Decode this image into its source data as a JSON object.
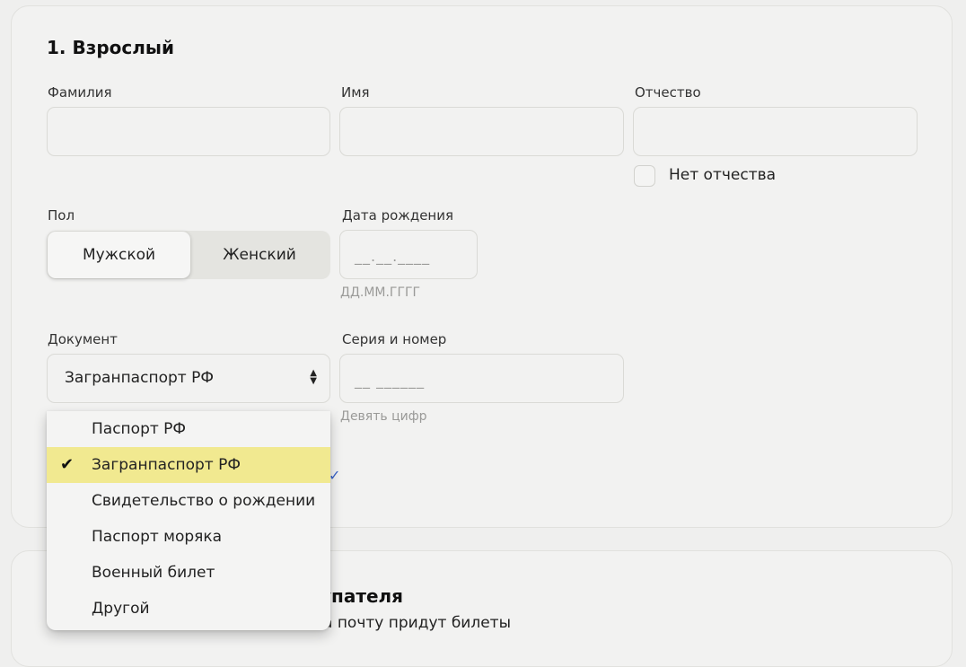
{
  "passenger": {
    "title": "1. Взрослый",
    "last_name": {
      "label": "Фамилия",
      "value": ""
    },
    "first_name": {
      "label": "Имя",
      "value": ""
    },
    "patronymic": {
      "label": "Отчество",
      "value": "",
      "no_patronymic_label": "Нет отчества",
      "no_patronymic_checked": false
    },
    "gender": {
      "label": "Пол",
      "options": [
        "Мужской",
        "Женский"
      ],
      "selected": "Мужской"
    },
    "birth_date": {
      "label": "Дата рождения",
      "mask": "__.__.____",
      "hint": "ДД.ММ.ГГГГ"
    },
    "document": {
      "label": "Документ",
      "selected": "Загранпаспорт РФ",
      "options": [
        "Паспорт РФ",
        "Загранпаспорт РФ",
        "Свидетельство о рождении",
        "Паспорт моряка",
        "Военный билет",
        "Другой"
      ],
      "selected_index": 1
    },
    "series_number": {
      "label": "Серия и номер",
      "mask": "__ ______",
      "hint": "Девять цифр"
    }
  },
  "buyer": {
    "title_fragment": "упателя",
    "subtitle_fragment": "а почту придут билеты"
  },
  "colors": {
    "selected_option_bg": "#f1e990",
    "background": "#efefee",
    "card": "#f2f2f1"
  }
}
